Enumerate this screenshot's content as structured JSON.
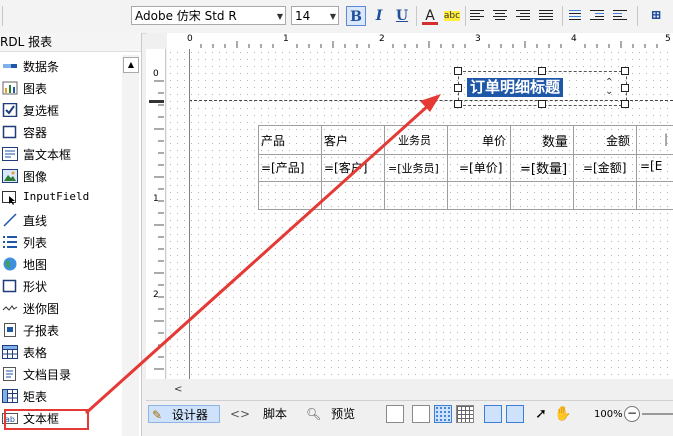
{
  "toolbar": {
    "font_name": "Adobe 仿宋 Std R",
    "font_size": "14",
    "bold": "B",
    "italic": "I",
    "underline": "U",
    "font_color_icon": "A",
    "highlight_icon": "abc"
  },
  "left_panel": {
    "header": "RDL 报表",
    "items": [
      {
        "label": "数据条",
        "icon": "databar-icon"
      },
      {
        "label": "图表",
        "icon": "chart-icon"
      },
      {
        "label": "复选框",
        "icon": "checkbox-icon"
      },
      {
        "label": "容器",
        "icon": "container-icon"
      },
      {
        "label": "富文本框",
        "icon": "richtext-icon"
      },
      {
        "label": "图像",
        "icon": "image-icon"
      },
      {
        "label": "InputField",
        "icon": "inputfield-icon"
      },
      {
        "label": "直线",
        "icon": "line-icon"
      },
      {
        "label": "列表",
        "icon": "list-icon"
      },
      {
        "label": "地图",
        "icon": "map-icon"
      },
      {
        "label": "形状",
        "icon": "shape-icon"
      },
      {
        "label": "迷你图",
        "icon": "sparkline-icon"
      },
      {
        "label": "子报表",
        "icon": "subreport-icon"
      },
      {
        "label": "表格",
        "icon": "table-icon"
      },
      {
        "label": "文档目录",
        "icon": "toc-icon"
      },
      {
        "label": "矩表",
        "icon": "matrix-icon"
      },
      {
        "label": "文本框",
        "icon": "textbox-icon"
      }
    ]
  },
  "ruler": {
    "top_marks": [
      "0",
      "1",
      "2",
      "3",
      "4",
      "5"
    ],
    "left_marks": [
      "0",
      "1",
      "2"
    ]
  },
  "report": {
    "title": "订单明细标题",
    "headers": [
      "产品",
      "客户",
      "业务员",
      "单价",
      "数量",
      "金额"
    ],
    "values": [
      "=[产品]",
      "=[客户]",
      "=[业务员]",
      "=[单价]",
      "=[数量]",
      "=[金额]",
      "=[E"
    ]
  },
  "bottom": {
    "designer": "设计器",
    "script": "脚本",
    "preview": "预览",
    "zoom": "100%"
  },
  "colors": {
    "highlight": "#e53935",
    "title_bg": "#1e56a8",
    "accent": "#3c7fd4"
  }
}
